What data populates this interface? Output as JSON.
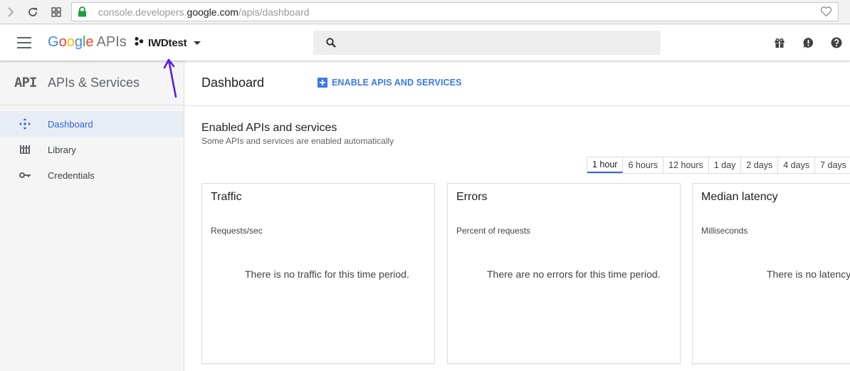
{
  "browser": {
    "url_prefix": "console.developers.",
    "url_host": "google.com",
    "url_path": "/apis/dashboard",
    "icons": [
      "forward-arrow-icon",
      "reload-icon",
      "apps-grid-icon",
      "lock-icon",
      "heart-icon"
    ]
  },
  "header": {
    "logo_letters": [
      "G",
      "o",
      "o",
      "g",
      "l",
      "e"
    ],
    "logo_suffix": "APIs",
    "project_name": "IWDtest",
    "icons": [
      "menu-icon",
      "search-icon",
      "gift-icon",
      "alert-icon",
      "help-icon"
    ]
  },
  "sidebar": {
    "logo_mark": "API",
    "title": "APIs & Services",
    "items": [
      {
        "label": "Dashboard",
        "icon": "dashboard-icon",
        "active": true
      },
      {
        "label": "Library",
        "icon": "library-icon",
        "active": false
      },
      {
        "label": "Credentials",
        "icon": "key-icon",
        "active": false
      }
    ]
  },
  "main": {
    "title": "Dashboard",
    "enable_button": "ENABLE APIS AND SERVICES",
    "section_title": "Enabled APIs and services",
    "section_subtitle": "Some APIs and services are enabled automatically",
    "time_ranges": [
      "1 hour",
      "6 hours",
      "12 hours",
      "1 day",
      "2 days",
      "4 days",
      "7 days"
    ],
    "selected_range": "1 hour",
    "cards": [
      {
        "title": "Traffic",
        "unit": "Requests/sec",
        "empty_message": "There is no traffic for this time period."
      },
      {
        "title": "Errors",
        "unit": "Percent of requests",
        "empty_message": "There are no errors for this time period."
      },
      {
        "title": "Median latency",
        "unit": "Milliseconds",
        "empty_message": "There is no latency data for this time period."
      }
    ]
  },
  "colors": {
    "accent": "#3367d6",
    "annotation_arrow": "#5b1ee8"
  }
}
